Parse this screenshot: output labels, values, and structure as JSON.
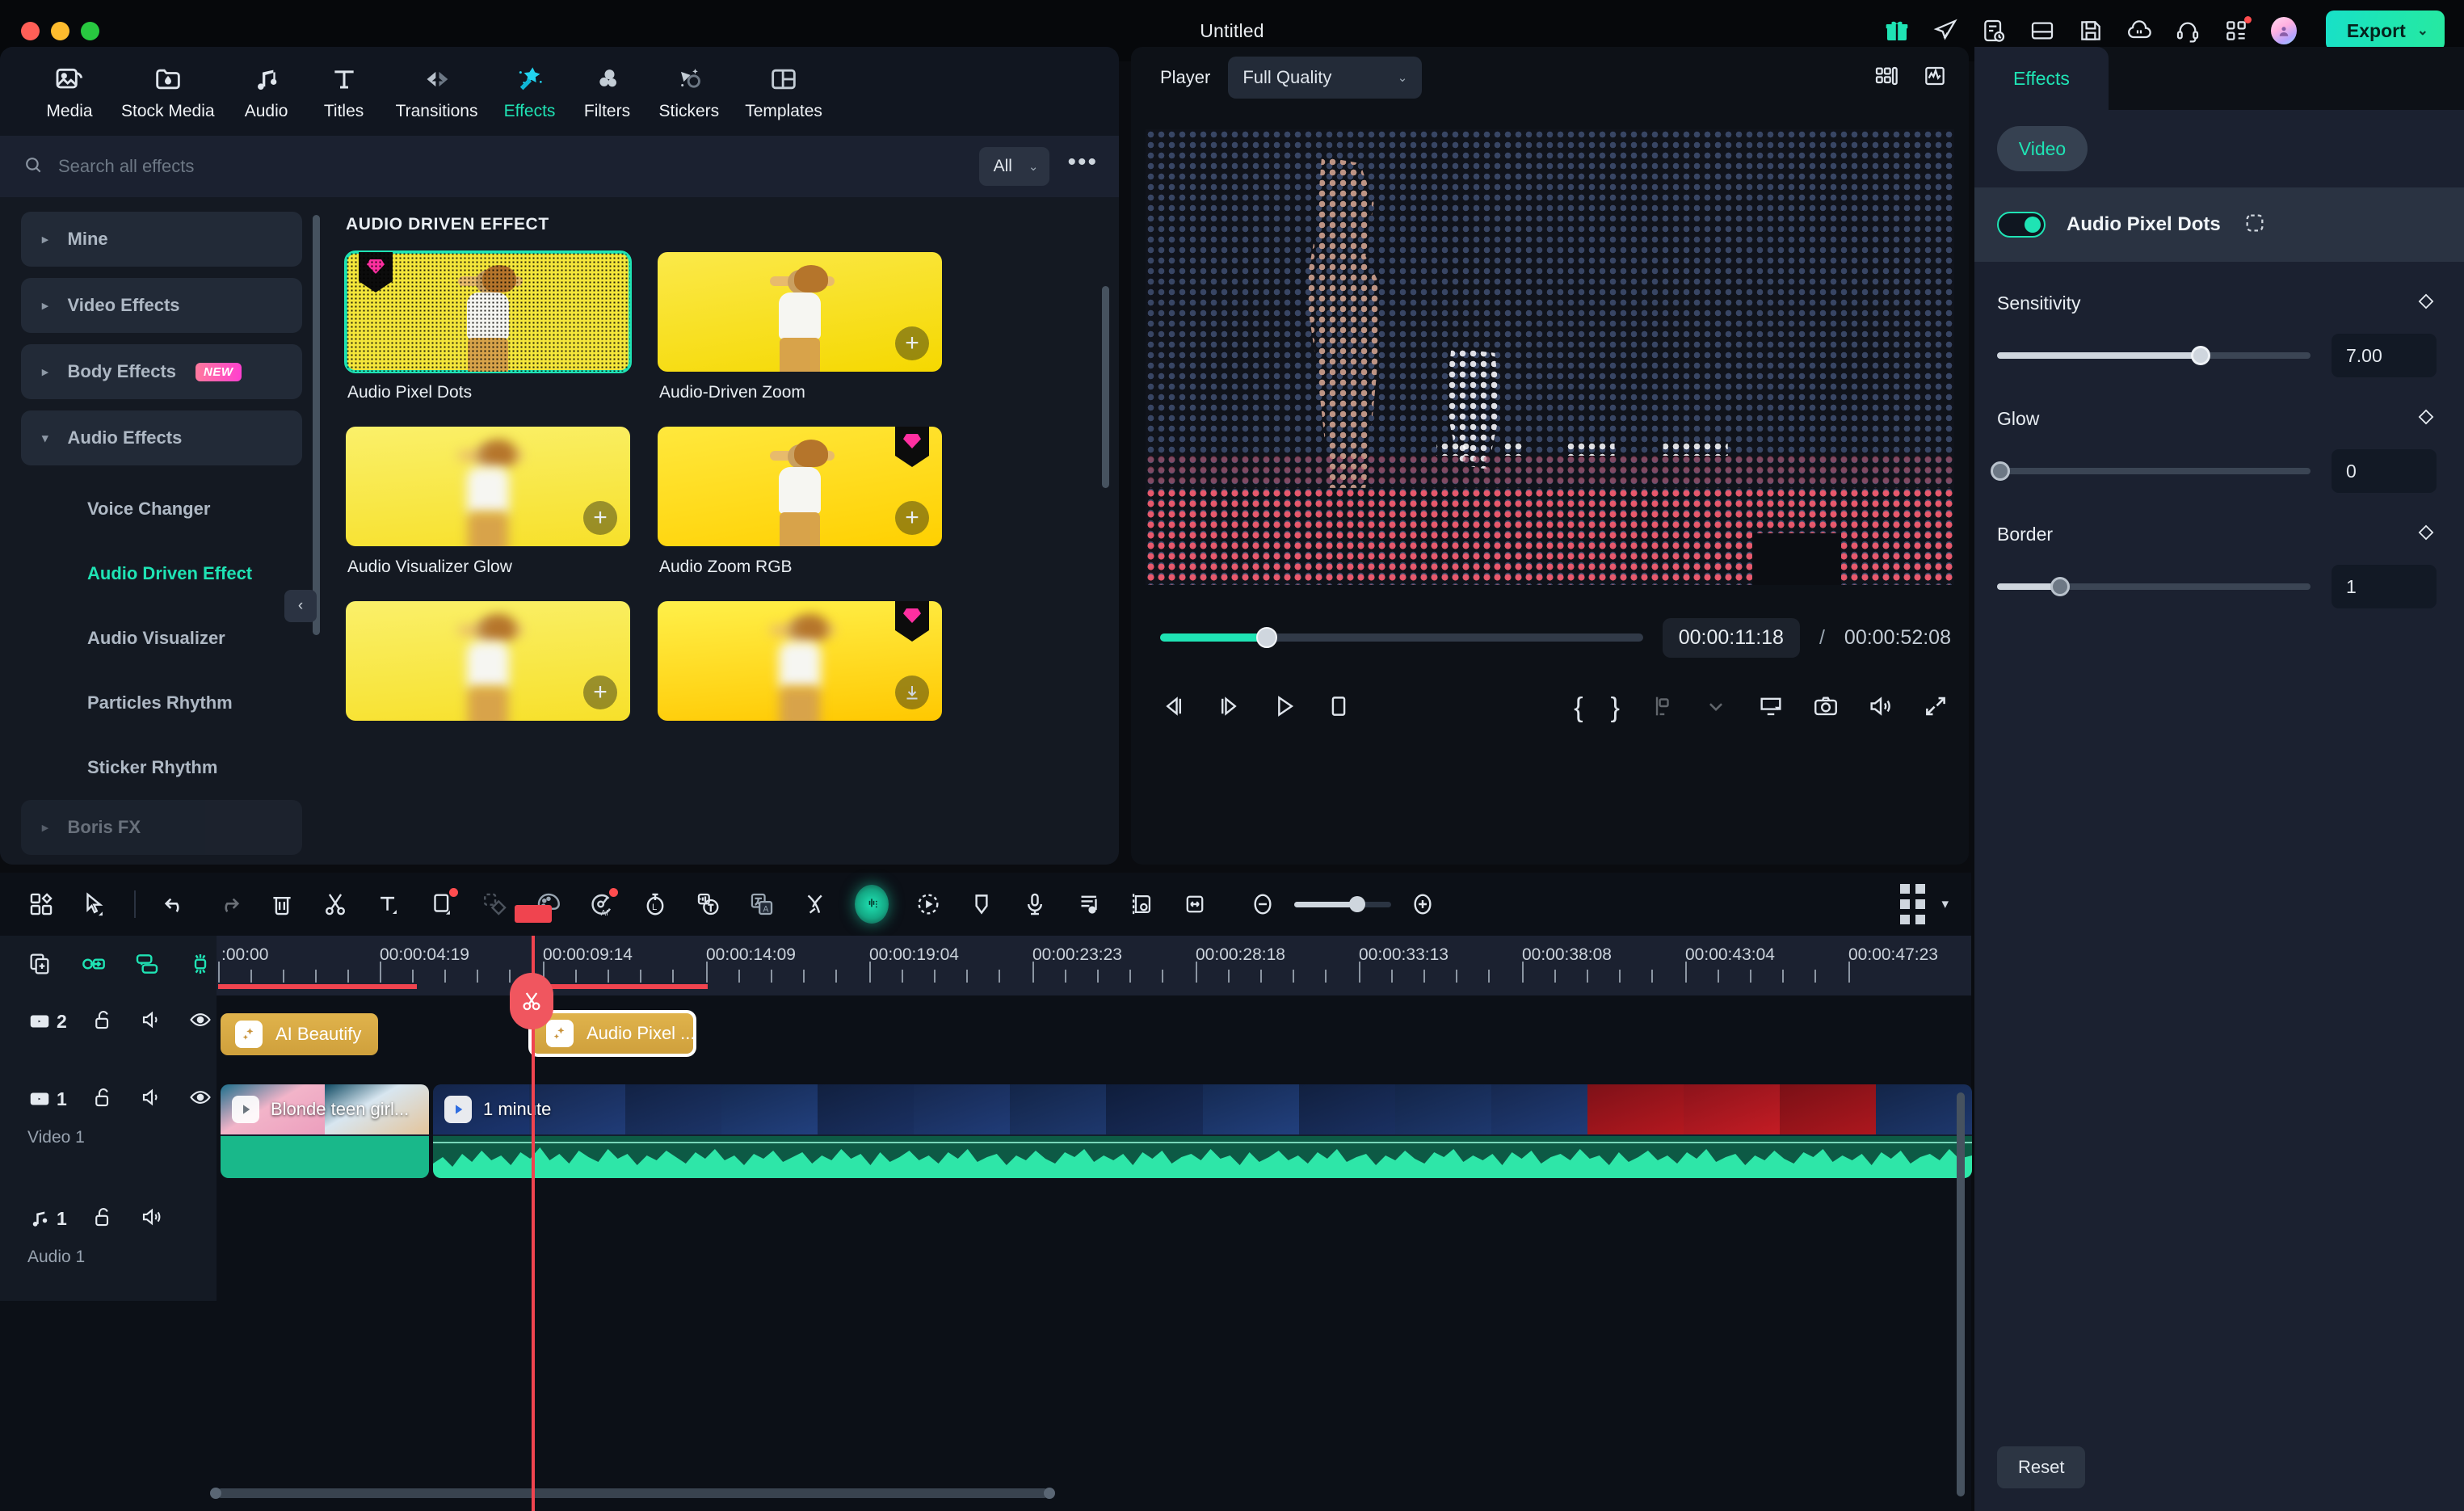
{
  "window": {
    "title": "Untitled",
    "traffic_lights": [
      "close",
      "minimize",
      "maximize"
    ]
  },
  "header": {
    "icons": [
      "gift-icon",
      "rocket-send-icon",
      "task-list-clock-icon",
      "layout-panel-icon",
      "save-icon",
      "cloud-sync-icon",
      "headset-support-icon",
      "apps-grid-icon"
    ],
    "avatar": "user-avatar",
    "export_label": "Export",
    "export_chevron": "⌄",
    "accent": "#1fe3b4"
  },
  "browser": {
    "tabs": [
      {
        "label": "Media",
        "icon": "media-image-icon",
        "active": false
      },
      {
        "label": "Stock Media",
        "icon": "stock-media-folder-icon",
        "active": false
      },
      {
        "label": "Audio",
        "icon": "music-note-icon",
        "active": false
      },
      {
        "label": "Titles",
        "icon": "text-t-icon",
        "active": false
      },
      {
        "label": "Transitions",
        "icon": "transitions-arrows-icon",
        "active": false
      },
      {
        "label": "Effects",
        "icon": "magic-wand-sparkle-icon",
        "active": true
      },
      {
        "label": "Filters",
        "icon": "filters-circles-icon",
        "active": false
      },
      {
        "label": "Stickers",
        "icon": "stickers-shapes-icon",
        "active": false
      },
      {
        "label": "Templates",
        "icon": "templates-layout-icon",
        "active": false
      }
    ],
    "search": {
      "placeholder": "Search all effects",
      "value": "",
      "icon": "search-icon"
    },
    "filter_select": {
      "value": "All",
      "chevron": "⌄"
    },
    "more_button": "•••",
    "categories": [
      {
        "label": "Mine",
        "type": "group",
        "expanded": false,
        "arrow": "▸",
        "badge": ""
      },
      {
        "label": "Video Effects",
        "type": "group",
        "expanded": false,
        "arrow": "▸",
        "badge": ""
      },
      {
        "label": "Body Effects",
        "type": "group",
        "expanded": false,
        "arrow": "▸",
        "badge": "NEW"
      },
      {
        "label": "Audio Effects",
        "type": "group",
        "expanded": true,
        "arrow": "▾",
        "badge": ""
      },
      {
        "label": "Voice Changer",
        "type": "sub",
        "active": false
      },
      {
        "label": "Audio Driven Effect",
        "type": "sub",
        "active": true
      },
      {
        "label": "Audio Visualizer",
        "type": "sub",
        "active": false
      },
      {
        "label": "Particles Rhythm",
        "type": "sub",
        "active": false
      },
      {
        "label": "Sticker Rhythm",
        "type": "sub",
        "active": false
      },
      {
        "label": "Boris FX",
        "type": "group",
        "expanded": false,
        "arrow": "▸",
        "badge": ""
      }
    ],
    "collapse_button": "‹",
    "section_title": "AUDIO DRIVEN EFFECT",
    "effects": [
      {
        "label": "Audio Pixel Dots",
        "selected": true,
        "premium": true,
        "action": "none",
        "style": "pixel"
      },
      {
        "label": "Audio-Driven Zoom",
        "selected": false,
        "premium": false,
        "action": "add",
        "style": "y1"
      },
      {
        "label": "Audio Visualizer Glow",
        "selected": false,
        "premium": false,
        "action": "add",
        "style": "y3"
      },
      {
        "label": "Audio Zoom RGB",
        "selected": false,
        "premium": true,
        "action": "add",
        "style": "y2"
      },
      {
        "label": "",
        "selected": false,
        "premium": false,
        "action": "add",
        "style": "y3"
      },
      {
        "label": "",
        "selected": false,
        "premium": true,
        "action": "download",
        "style": "y4"
      }
    ]
  },
  "player": {
    "label": "Player",
    "quality": {
      "value": "Full Quality",
      "chevron": "⌄"
    },
    "top_right_icons": [
      "split-view-icon",
      "audio-waveform-graph-icon"
    ],
    "seek": {
      "progress_percent": 22
    },
    "timecode_current": "00:00:11:18",
    "timecode_separator": "/",
    "timecode_total": "00:00:52:08",
    "transport_left": [
      "prev-frame-icon",
      "next-frame-icon",
      "play-icon",
      "stop-icon"
    ],
    "transport_right": [
      "mark-in-brace-icon",
      "mark-out-brace-icon",
      "marker-icon",
      "chevron-down-icon",
      "screen-record-icon",
      "snapshot-camera-icon",
      "volume-icon",
      "fullscreen-icon"
    ],
    "brace_in": "{",
    "brace_out": "}"
  },
  "properties": {
    "tab_label": "Effects",
    "chip_label": "Video",
    "effect": {
      "name": "Audio Pixel Dots",
      "enabled": true,
      "mask_icon": "mask-selection-icon"
    },
    "controls": [
      {
        "label": "Sensitivity",
        "value": "7.00",
        "fill_percent": 65,
        "keyframe_icon": "keyframe-diamond-icon"
      },
      {
        "label": "Glow",
        "value": "0",
        "fill_percent": 0,
        "keyframe_icon": "keyframe-diamond-icon"
      },
      {
        "label": "Border",
        "value": "1",
        "fill_percent": 20,
        "keyframe_icon": "keyframe-diamond-icon"
      }
    ],
    "reset_label": "Reset"
  },
  "timeline": {
    "toolbar_icons": [
      "apps-diamond-icon",
      "select-cursor-icon",
      "divider",
      "undo-icon",
      "redo-icon",
      "delete-trash-icon",
      "split-scissors-icon",
      "add-text-icon",
      "crop-icon",
      "mask-icon",
      "color-palette-icon",
      "ai-audio-icon",
      "speed-ramp-icon",
      "speech-to-text-icon",
      "translate-icon",
      "detach-audio-icon",
      "ai-voice-icon",
      "motion-tracking-icon",
      "marker-pin-icon",
      "voiceover-mic-icon",
      "audio-mixer-icon",
      "keyframe-clip-icon",
      "fit-width-icon"
    ],
    "zoom": {
      "out_icon": "zoom-out-icon",
      "in_icon": "zoom-in-icon",
      "level_percent": 65
    },
    "view_icons": [
      "grid-view-icon",
      "chevron-down-icon"
    ],
    "ruler_left_icons": [
      "duplicate-icon",
      "link-clip-icon",
      "group-clips-icon",
      "snap-magnet-icon"
    ],
    "ruler_labels": [
      ":00:00",
      "00:00:04:19",
      "00:00:09:14",
      "00:00:14:09",
      "00:00:19:04",
      "00:00:23:23",
      "00:00:28:18",
      "00:00:33:13",
      "00:00:38:08",
      "00:00:43:04",
      "00:00:47:23"
    ],
    "playhead_timecode": "00:00:11:18",
    "split_button_icon": "scissors-icon",
    "tracks": [
      {
        "kind": "video",
        "number": "2",
        "name": "",
        "icons": [
          "video-track-icon",
          "unlock-icon",
          "speaker-icon",
          "eye-icon"
        ],
        "clips": [
          {
            "label": "AI Beautify",
            "type": "effect",
            "selected": false,
            "badge_icon": "effect-sparkle-icon"
          },
          {
            "label": "Audio Pixel ...",
            "type": "effect",
            "selected": true,
            "badge_icon": "effect-sparkle-icon"
          }
        ]
      },
      {
        "kind": "video",
        "number": "1",
        "name": "Video 1",
        "icons": [
          "video-track-icon",
          "unlock-icon",
          "speaker-icon",
          "eye-icon"
        ],
        "clips": [
          {
            "label": "Blonde teen girl...",
            "type": "video",
            "selected": false,
            "badge_icon": "play-icon"
          },
          {
            "label": "1 minute",
            "type": "video",
            "selected": false,
            "badge_icon": "play-icon"
          }
        ]
      },
      {
        "kind": "audio",
        "number": "1",
        "name": "Audio 1",
        "icons": [
          "music-note-icon",
          "unlock-icon",
          "speaker-icon"
        ],
        "clips": []
      }
    ]
  }
}
